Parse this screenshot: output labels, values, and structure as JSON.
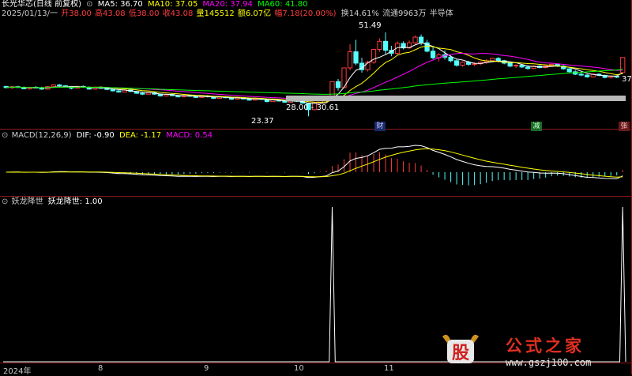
{
  "header": {
    "stock": "长光华芯(日线 前复权)",
    "ma5": "MA5: 36.70",
    "ma10": "MA10: 37.05",
    "ma20": "MA20: 37.94",
    "ma60": "MA60: 41.80",
    "date": "2025/01/13/一",
    "open": "开38.00",
    "high": "高43.08",
    "low": "低38.00",
    "close": "收43.08",
    "vol": "量145512",
    "amount": "额6.07亿",
    "change": "幅7.18(20.00%)",
    "turnover": "换14.61%",
    "float": "流通9963万",
    "sector": "半导体"
  },
  "macd_header": {
    "name": "MACD(12,26,9)",
    "dif": "DIF: -0.90",
    "dea": "DEA: -1.17",
    "macd": "MACD: 0.54"
  },
  "ind_header": {
    "name": "妖龙降世",
    "value": "妖龙降世: 1.00"
  },
  "annotations": {
    "peak": "51.49",
    "low": "23.37",
    "range": "28.00 - 30.61",
    "right": "37",
    "marker_cai": "财",
    "marker_jian": "减",
    "marker_zhang": "张"
  },
  "x_labels": [
    "2024年",
    "8",
    "9",
    "10",
    "11"
  ],
  "watermark": {
    "logo": "股",
    "title": "公式之家",
    "url": "www.gszj100.com"
  },
  "colors": {
    "up": "#ff3c3c",
    "down": "#54ffff",
    "ma5": "#ffffff",
    "ma10": "#ffff00",
    "ma20": "#ff00ff",
    "ma60": "#00ff00",
    "dif": "#ffffff",
    "dea": "#ffff00",
    "macd_up": "#ff3c3c",
    "macd_down": "#54ffff",
    "indicator": "#ffffff"
  },
  "chart_data": [
    {
      "type": "candlestick",
      "title": "长光华芯(日线 前复权)",
      "ylim": [
        20,
        56
      ],
      "series": [
        {
          "name": "MA5",
          "value": 36.7
        },
        {
          "name": "MA10",
          "value": 37.05
        },
        {
          "name": "MA20",
          "value": 37.94
        },
        {
          "name": "MA60",
          "value": 41.8
        }
      ],
      "candles": [
        [
          33.4,
          33.6,
          32.7,
          33.0
        ],
        [
          33.0,
          33.5,
          32.5,
          33.3
        ],
        [
          33.3,
          33.6,
          32.9,
          33.1
        ],
        [
          33.1,
          33.4,
          32.4,
          32.6
        ],
        [
          32.6,
          33.3,
          32.3,
          33.1
        ],
        [
          33.1,
          33.5,
          32.8,
          33.0
        ],
        [
          33.0,
          33.3,
          32.2,
          32.5
        ],
        [
          32.5,
          33.5,
          32.3,
          33.3
        ],
        [
          33.3,
          34.1,
          33.1,
          33.9
        ],
        [
          33.9,
          34.2,
          33.3,
          33.6
        ],
        [
          33.6,
          33.9,
          33.0,
          33.2
        ],
        [
          33.2,
          33.5,
          32.4,
          32.8
        ],
        [
          32.8,
          33.6,
          32.7,
          33.4
        ],
        [
          33.4,
          33.7,
          32.9,
          33.1
        ],
        [
          33.1,
          33.4,
          32.3,
          32.5
        ],
        [
          32.5,
          33.3,
          32.3,
          33.0
        ],
        [
          33.0,
          33.4,
          32.6,
          32.9
        ],
        [
          32.9,
          33.2,
          32.1,
          32.4
        ],
        [
          32.4,
          32.6,
          31.7,
          31.9
        ],
        [
          31.9,
          32.2,
          31.3,
          31.5
        ],
        [
          31.5,
          32.4,
          31.4,
          32.2
        ],
        [
          32.2,
          32.5,
          31.5,
          31.7
        ],
        [
          31.7,
          31.9,
          30.9,
          31.1
        ],
        [
          31.1,
          31.4,
          30.5,
          30.8
        ],
        [
          30.8,
          31.5,
          30.6,
          31.3
        ],
        [
          31.3,
          31.6,
          30.6,
          30.8
        ],
        [
          30.8,
          31.0,
          30.0,
          30.2
        ],
        [
          30.2,
          30.9,
          30.0,
          30.7
        ],
        [
          30.7,
          31.0,
          30.1,
          30.3
        ],
        [
          30.3,
          30.5,
          29.7,
          29.9
        ],
        [
          29.9,
          30.6,
          29.7,
          30.4
        ],
        [
          30.4,
          30.6,
          29.9,
          30.1
        ],
        [
          30.1,
          30.3,
          29.5,
          29.7
        ],
        [
          29.7,
          30.4,
          29.6,
          30.2
        ],
        [
          30.2,
          30.5,
          29.7,
          29.9
        ],
        [
          29.9,
          30.1,
          29.2,
          29.4
        ],
        [
          29.4,
          30.1,
          29.3,
          29.9
        ],
        [
          29.9,
          30.1,
          29.4,
          29.6
        ],
        [
          29.6,
          29.8,
          28.9,
          29.1
        ],
        [
          29.1,
          29.8,
          28.9,
          29.6
        ],
        [
          29.6,
          29.8,
          29.0,
          29.2
        ],
        [
          29.2,
          29.4,
          28.6,
          28.8
        ],
        [
          28.8,
          29.5,
          28.6,
          29.3
        ],
        [
          29.3,
          29.5,
          28.9,
          29.1
        ],
        [
          29.1,
          29.2,
          28.1,
          28.3
        ],
        [
          28.3,
          29.1,
          28.2,
          28.9
        ],
        [
          28.9,
          29.1,
          28.3,
          28.5
        ],
        [
          28.5,
          28.7,
          27.9,
          28.1
        ],
        [
          28.1,
          28.9,
          27.9,
          28.7
        ],
        [
          28.7,
          28.9,
          28.2,
          28.4
        ],
        [
          28.4,
          28.6,
          27.6,
          27.8
        ],
        [
          27.8,
          27.9,
          23.37,
          25.6
        ],
        [
          25.6,
          28.2,
          25.4,
          28.0
        ],
        [
          28.0,
          29.2,
          27.6,
          28.8
        ],
        [
          28.8,
          29.5,
          27.9,
          29.2
        ],
        [
          29.2,
          35.0,
          29.0,
          35.0
        ],
        [
          35.0,
          35.9,
          32.0,
          33.0
        ],
        [
          33.0,
          39.6,
          32.8,
          39.6
        ],
        [
          39.6,
          47.5,
          38.8,
          45.0
        ],
        [
          45.0,
          49.0,
          40.5,
          41.2
        ],
        [
          41.2,
          43.0,
          38.0,
          39.0
        ],
        [
          39.0,
          42.0,
          38.4,
          41.5
        ],
        [
          41.5,
          46.0,
          41.0,
          45.8
        ],
        [
          45.8,
          49.5,
          45.0,
          48.5
        ],
        [
          48.5,
          51.49,
          44.0,
          45.5
        ],
        [
          45.5,
          47.0,
          43.5,
          44.5
        ],
        [
          44.5,
          48.5,
          44.0,
          47.8
        ],
        [
          47.8,
          48.5,
          45.8,
          46.3
        ],
        [
          46.3,
          48.8,
          46.0,
          48.0
        ],
        [
          48.0,
          50.5,
          47.5,
          49.9
        ],
        [
          49.9,
          50.8,
          47.2,
          48.0
        ],
        [
          48.0,
          49.0,
          44.8,
          45.2
        ],
        [
          45.2,
          46.5,
          42.5,
          43.0
        ],
        [
          43.0,
          44.5,
          41.8,
          44.0
        ],
        [
          44.0,
          45.5,
          42.4,
          43.2
        ],
        [
          43.2,
          43.8,
          41.5,
          42.0
        ],
        [
          42.0,
          42.5,
          40.0,
          40.5
        ],
        [
          40.5,
          41.8,
          40.0,
          41.5
        ],
        [
          41.5,
          42.0,
          40.3,
          40.8
        ],
        [
          40.8,
          41.5,
          40.2,
          41.0
        ],
        [
          41.0,
          41.8,
          40.5,
          41.5
        ],
        [
          41.5,
          42.5,
          41.0,
          42.0
        ],
        [
          42.0,
          43.0,
          41.8,
          42.8
        ],
        [
          42.8,
          43.2,
          41.5,
          42.0
        ],
        [
          42.0,
          42.3,
          40.8,
          41.2
        ],
        [
          41.2,
          41.5,
          39.8,
          40.2
        ],
        [
          40.2,
          40.8,
          39.5,
          40.5
        ],
        [
          40.5,
          40.9,
          39.6,
          39.9
        ],
        [
          39.9,
          40.2,
          39.0,
          39.4
        ],
        [
          39.4,
          40.5,
          39.2,
          40.2
        ],
        [
          40.2,
          40.5,
          39.5,
          39.7
        ],
        [
          39.7,
          40.5,
          39.5,
          40.3
        ],
        [
          40.3,
          41.0,
          40.0,
          40.8
        ],
        [
          40.8,
          41.0,
          39.9,
          40.2
        ],
        [
          40.2,
          40.5,
          39.0,
          39.3
        ],
        [
          39.3,
          39.5,
          38.0,
          38.3
        ],
        [
          38.3,
          38.8,
          37.2,
          37.5
        ],
        [
          37.5,
          38.0,
          36.8,
          37.2
        ],
        [
          37.2,
          37.5,
          36.3,
          36.6
        ],
        [
          36.6,
          37.8,
          36.4,
          37.5
        ],
        [
          37.5,
          37.8,
          36.8,
          37.1
        ],
        [
          37.1,
          37.3,
          36.1,
          36.4
        ],
        [
          36.4,
          37.0,
          36.0,
          36.8
        ],
        [
          36.8,
          37.1,
          36.2,
          36.5
        ],
        [
          38.0,
          43.08,
          38.0,
          43.08
        ]
      ],
      "annotations": [
        "51.49",
        "23.37",
        "28.00 - 30.61",
        "37"
      ]
    },
    {
      "type": "bar",
      "title": "MACD(12,26,9)",
      "series": [
        {
          "name": "DIF",
          "value": -0.9
        },
        {
          "name": "DEA",
          "value": -1.17
        },
        {
          "name": "MACD",
          "value": 0.54
        }
      ]
    },
    {
      "type": "line",
      "title": "妖龙降世",
      "x": [
        "2024年",
        "8",
        "9",
        "10",
        "11"
      ],
      "ylim": [
        0,
        1
      ],
      "values": [
        0,
        0,
        0,
        0,
        0,
        0,
        0,
        0,
        0,
        0,
        0,
        0,
        0,
        0,
        0,
        0,
        0,
        0,
        0,
        0,
        0,
        0,
        0,
        0,
        0,
        0,
        0,
        0,
        0,
        0,
        0,
        0,
        0,
        0,
        0,
        0,
        0,
        0,
        0,
        0,
        0,
        0,
        0,
        0,
        0,
        0,
        0,
        0,
        0,
        0,
        0,
        0,
        0,
        0,
        0,
        1,
        0,
        0,
        0,
        0,
        0,
        0,
        0,
        0,
        0,
        0,
        0,
        0,
        0,
        0,
        0,
        0,
        0,
        0,
        0,
        0,
        0,
        0,
        0,
        0,
        0,
        0,
        0,
        0,
        0,
        0,
        0,
        0,
        0,
        0,
        0,
        0,
        0,
        0,
        0,
        0,
        0,
        0,
        0,
        0,
        0,
        0,
        0,
        0,
        1
      ],
      "series": [
        {
          "name": "妖龙降世",
          "value": 1.0
        }
      ]
    }
  ]
}
